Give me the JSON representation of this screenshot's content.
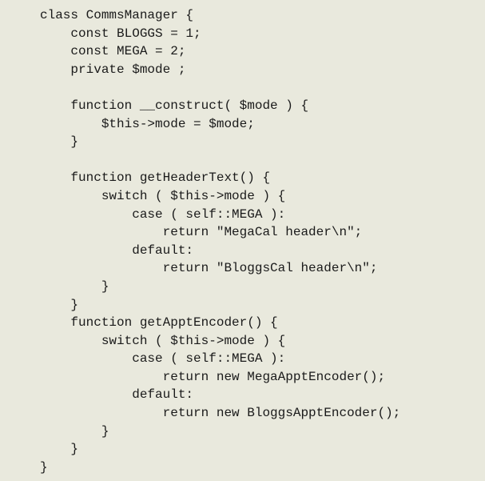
{
  "code": {
    "lines": [
      "class CommsManager {",
      "    const BLOGGS = 1;",
      "    const MEGA = 2;",
      "    private $mode ;",
      "",
      "    function __construct( $mode ) {",
      "        $this->mode = $mode;",
      "    }",
      "",
      "    function getHeaderText() {",
      "        switch ( $this->mode ) {",
      "            case ( self::MEGA ):",
      "                return \"MegaCal header\\n\";",
      "            default:",
      "                return \"BloggsCal header\\n\";",
      "        }",
      "    }",
      "    function getApptEncoder() {",
      "        switch ( $this->mode ) {",
      "            case ( self::MEGA ):",
      "                return new MegaApptEncoder();",
      "            default:",
      "                return new BloggsApptEncoder();",
      "        }",
      "    }",
      "}"
    ]
  }
}
